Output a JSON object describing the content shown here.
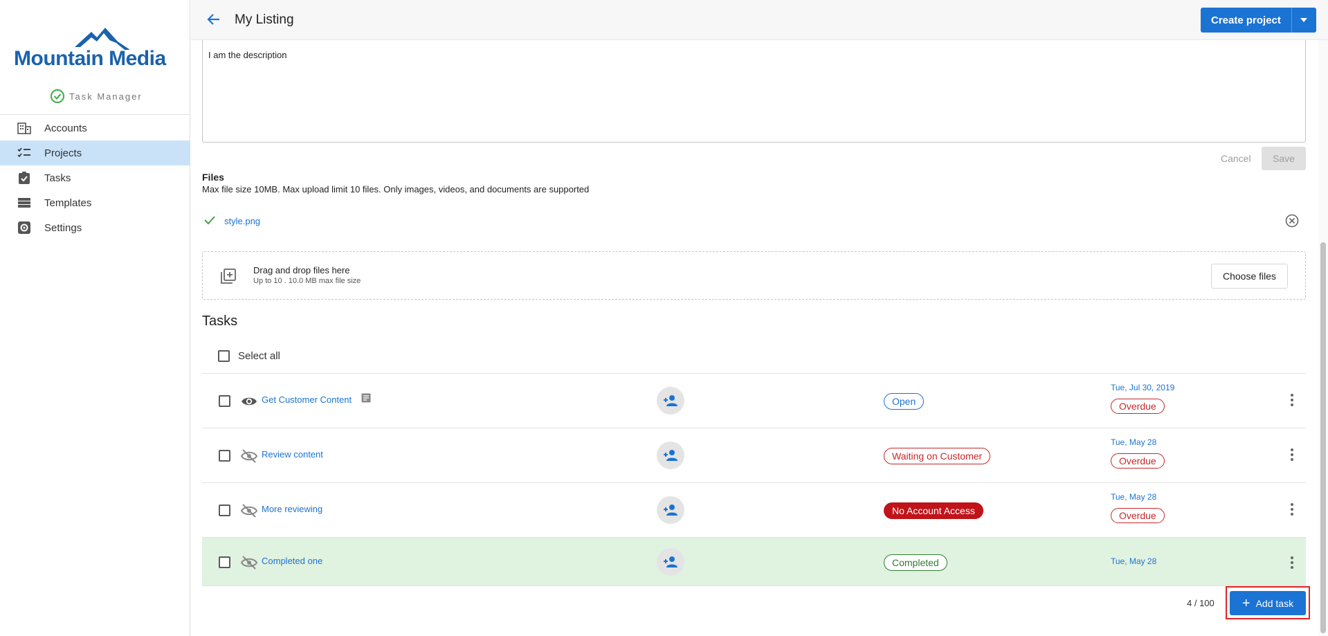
{
  "brand": {
    "logo_text": "Mountain Media",
    "product": "Task Manager",
    "logo_color": "#1a62ad"
  },
  "sidebar": {
    "items": [
      {
        "label": "Accounts",
        "icon": "building-icon",
        "active": false
      },
      {
        "label": "Projects",
        "icon": "checklist-icon",
        "active": true
      },
      {
        "label": "Tasks",
        "icon": "clipboard-check-icon",
        "active": false
      },
      {
        "label": "Templates",
        "icon": "table-icon",
        "active": false
      },
      {
        "label": "Settings",
        "icon": "gear-icon",
        "active": false
      }
    ]
  },
  "header": {
    "title": "My Listing",
    "create_label": "Create project"
  },
  "description": {
    "value": "I am the description",
    "cancel_label": "Cancel",
    "save_label": "Save"
  },
  "files": {
    "title": "Files",
    "subtitle": "Max file size 10MB. Max upload limit 10 files. Only images, videos, and documents are supported",
    "uploaded": [
      {
        "name": "style.png"
      }
    ],
    "drop_title": "Drag and drop files here",
    "drop_subtitle": "Up to 10 . 10.0 MB max file size",
    "choose_label": "Choose files"
  },
  "tasks": {
    "title": "Tasks",
    "select_all_label": "Select all",
    "rows": [
      {
        "name": "Get Customer Content",
        "visible": true,
        "has_note": true,
        "status": "Open",
        "date": "Tue, Jul 30, 2019",
        "overdue": "Overdue"
      },
      {
        "name": "Review content",
        "visible": false,
        "has_note": false,
        "status": "Waiting on Customer",
        "date": "Tue, May 28",
        "overdue": "Overdue"
      },
      {
        "name": "More reviewing",
        "visible": false,
        "has_note": false,
        "status": "No Account Access",
        "date": "Tue, May 28",
        "overdue": "Overdue"
      },
      {
        "name": "Completed one",
        "visible": false,
        "has_note": false,
        "status": "Completed",
        "date": "Tue, May 28",
        "overdue": ""
      }
    ],
    "count": "4 / 100",
    "add_label": "Add task"
  },
  "colors": {
    "accent": "#1b73d3",
    "active_nav": "#c9e2f8",
    "danger": "#c62828",
    "success": "#2e7d32",
    "completed_row": "#e0f2e0"
  }
}
